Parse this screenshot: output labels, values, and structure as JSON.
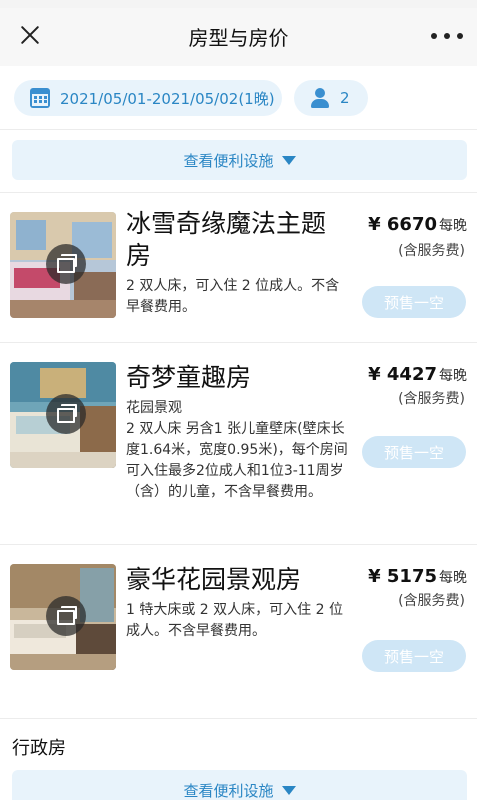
{
  "header": {
    "title": "房型与房价"
  },
  "filters": {
    "date_range": "2021/05/01-2021/05/02(1晚)",
    "guests": "2"
  },
  "amenities_label": "查看便利设施",
  "rooms": [
    {
      "name": "冰雪奇缘魔法主题房",
      "description": "2 双人床，可入住 2 位成人。不含早餐费用。",
      "price": "¥ 6670",
      "price_unit": "每晚",
      "price_note": "(含服务费)",
      "button": "预售一空"
    },
    {
      "name": "奇梦童趣房",
      "description": "花园景观\n2 双人床 另含1 张儿童壁床(壁床长度1.64米，宽度0.95米)，每个房间可入住最多2位成人和1位3-11周岁（含）的儿童，不含早餐费用。",
      "price": "¥ 4427",
      "price_unit": "每晚",
      "price_note": "(含服务费)",
      "button": "预售一空"
    },
    {
      "name": "豪华花园景观房",
      "description": "1 特大床或 2 双人床，可入住 2 位成人。不含早餐费用。",
      "price": "¥ 5175",
      "price_unit": "每晚",
      "price_note": "(含服务费)",
      "button": "预售一空"
    }
  ],
  "section2": {
    "title": "行政房",
    "amenities_label": "查看便利设施"
  },
  "colors": {
    "accent": "#2a86c4",
    "pill_bg": "#e8f3fb",
    "disabled_button": "#cfe6f6"
  }
}
